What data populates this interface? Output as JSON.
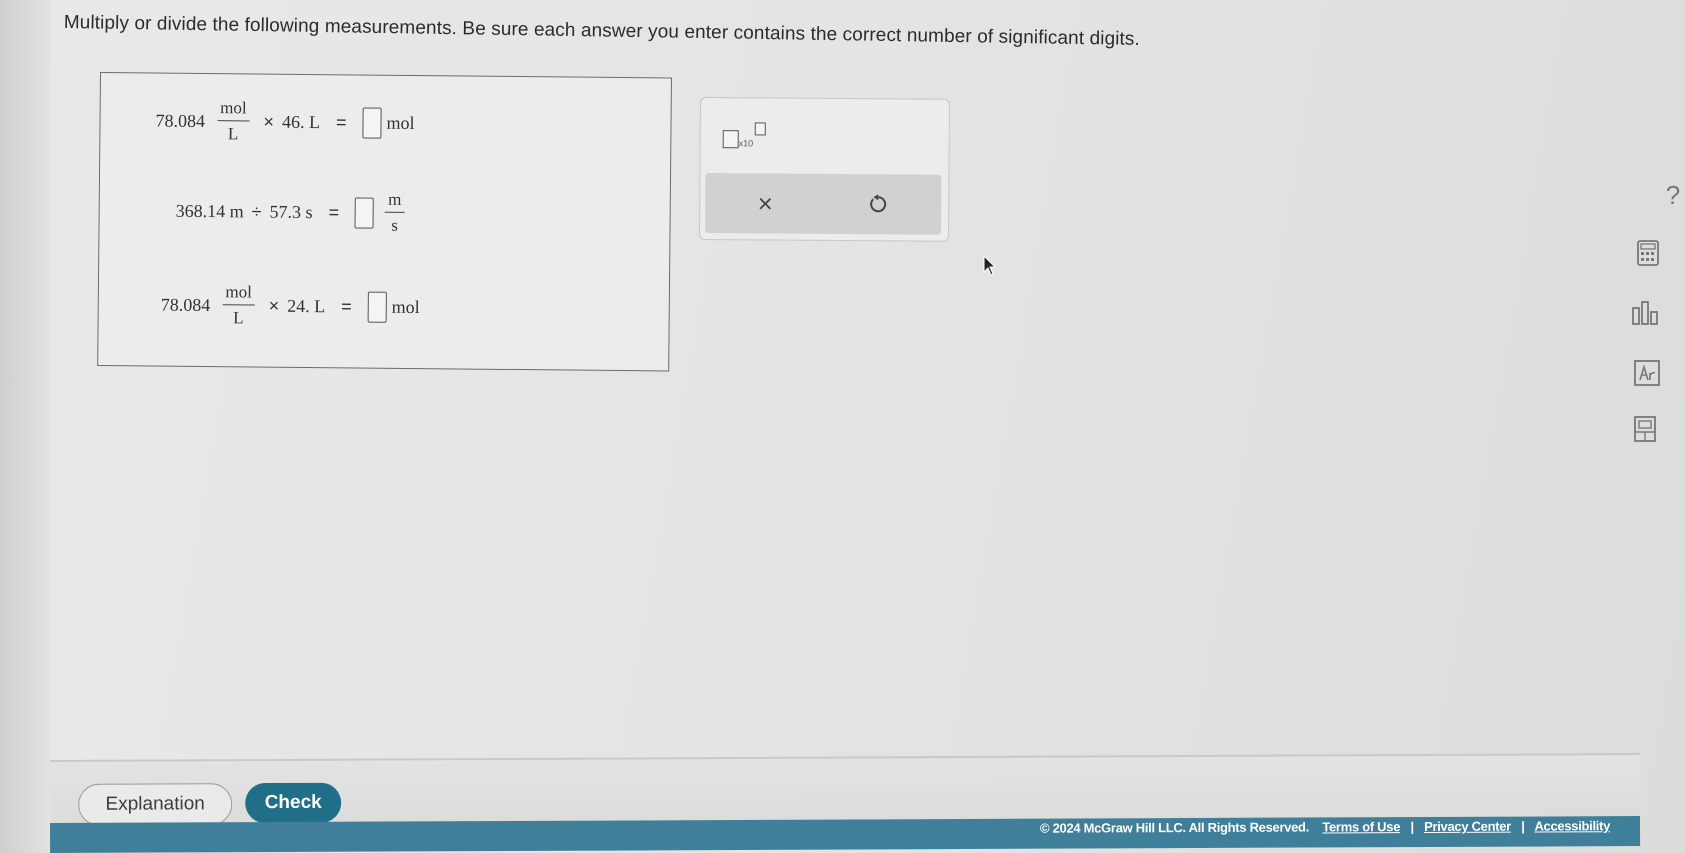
{
  "instructions": "Multiply or divide the following measurements. Be sure each answer you enter contains the correct number of significant digits.",
  "problems": [
    {
      "value": "78.084",
      "unit_num": "mol",
      "unit_den": "L",
      "operator": "×",
      "second": "46. L",
      "equals": "=",
      "answer_value": "",
      "answer_unit": "mol"
    },
    {
      "first": "368.14 m",
      "operator": "÷",
      "second": "57.3 s",
      "equals": "=",
      "answer_value": "",
      "answer_unit_num": "m",
      "answer_unit_den": "s"
    },
    {
      "value": "78.084",
      "unit_num": "mol",
      "unit_den": "L",
      "operator": "×",
      "second": "24. L",
      "equals": "=",
      "answer_value": "",
      "answer_unit": "mol"
    }
  ],
  "tools": {
    "sci_notation_label": "x10",
    "clear_symbol": "×",
    "undo_symbol": "↺"
  },
  "side_tools": {
    "help_symbol": "?",
    "items": [
      "help-icon",
      "calculator-icon",
      "data-chart-icon",
      "periodic-table-icon",
      "reference-icon"
    ]
  },
  "buttons": {
    "explanation": "Explanation",
    "check": "Check"
  },
  "footer": {
    "copyright": "© 2024 McGraw Hill LLC. All Rights Reserved.",
    "terms": "Terms of Use",
    "privacy": "Privacy Center",
    "accessibility": "Accessibility",
    "separator": "|"
  },
  "colors": {
    "check_button": "#1f6f88",
    "footer_bg": "#3f7f99"
  }
}
